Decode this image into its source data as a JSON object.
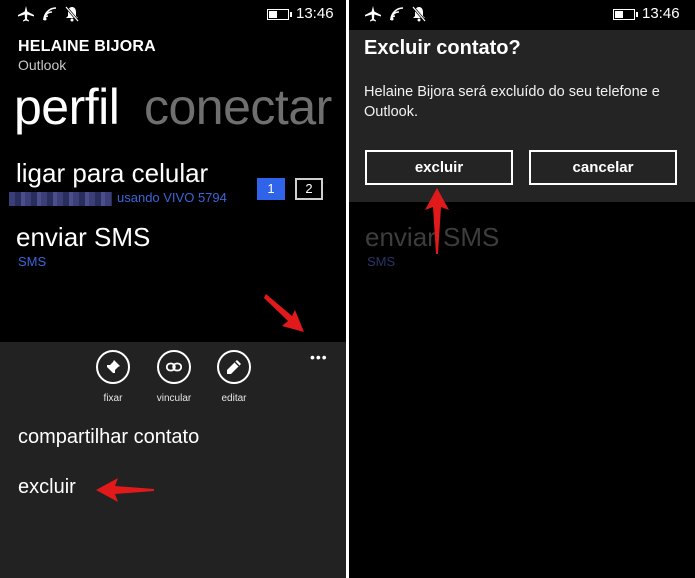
{
  "status_bar": {
    "time": "13:46"
  },
  "left_panel": {
    "contact": {
      "name": "HELAINE BIJORA",
      "source": "Outlook"
    },
    "pivots": {
      "active": "perfil",
      "inactive": "conectar"
    },
    "call": {
      "title": "ligar para celular",
      "subtitle": "usando VIVO 5794",
      "sim1": "1",
      "sim2": "2"
    },
    "sms": {
      "title": "enviar SMS",
      "subtitle": "SMS"
    },
    "app_bar": {
      "more": "•••",
      "buttons": [
        {
          "label": "fixar",
          "icon": "pin-icon"
        },
        {
          "label": "vincular",
          "icon": "link-icon"
        },
        {
          "label": "editar",
          "icon": "pencil-icon"
        }
      ],
      "menu": [
        "compartilhar contato",
        "excluir"
      ]
    }
  },
  "right_panel": {
    "dialog": {
      "title": "Excluir contato?",
      "message": "Helaine Bijora será excluído do seu telefone e Outlook.",
      "confirm": "excluir",
      "cancel": "cancelar"
    },
    "background": {
      "title": "enviar SMS",
      "subtitle": "SMS"
    }
  },
  "colors": {
    "accent": "#2e63ea",
    "link": "#3a66d9",
    "annotation_arrow": "#e01a1a"
  }
}
